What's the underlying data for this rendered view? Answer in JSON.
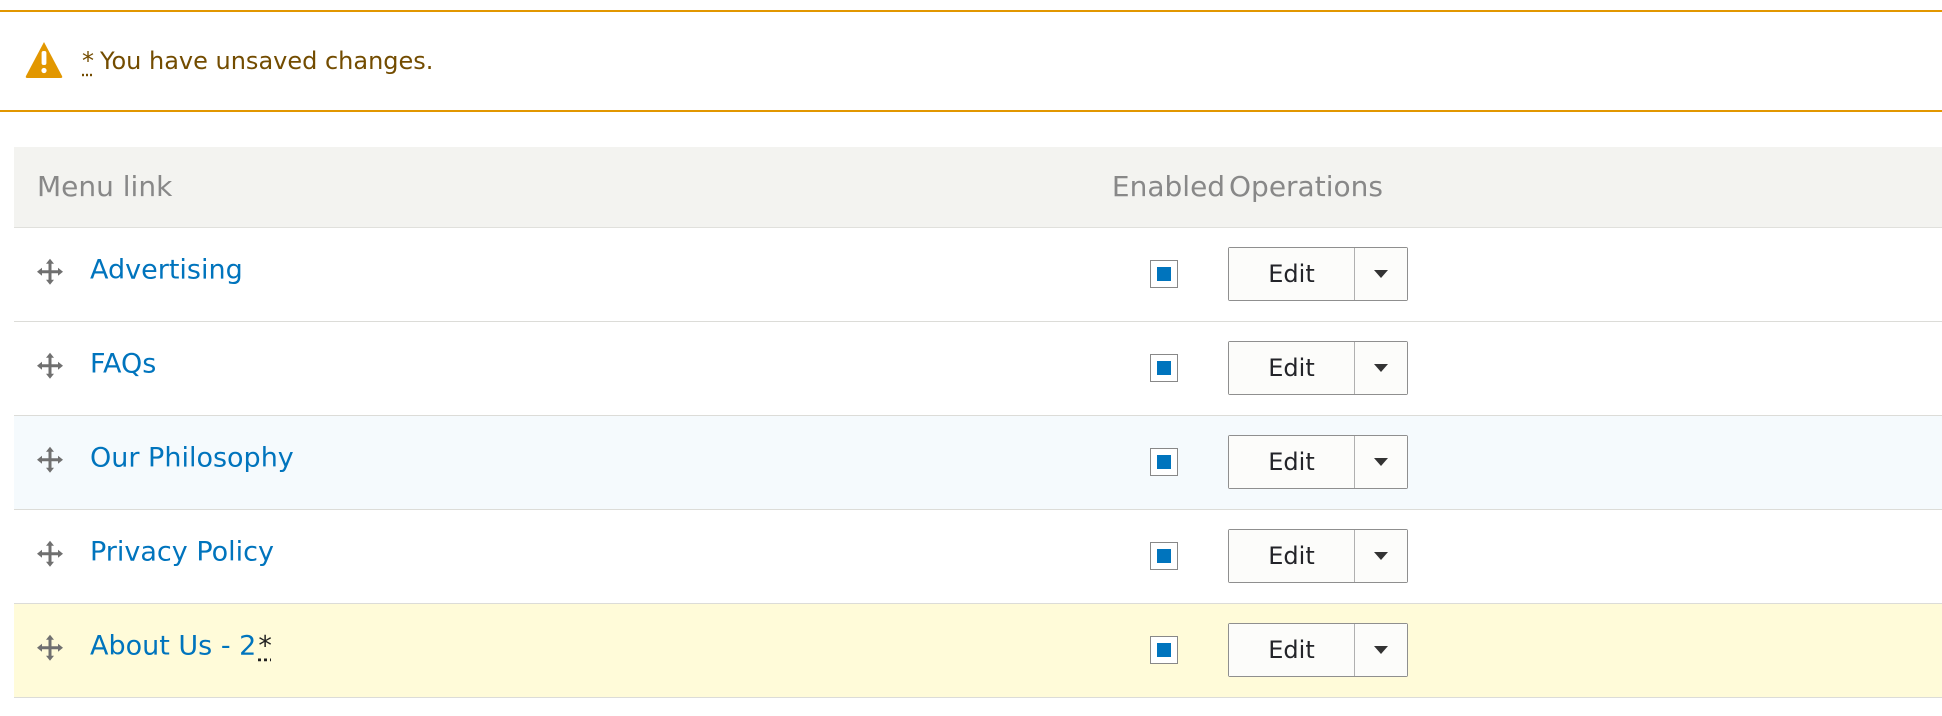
{
  "status": {
    "icon": "warning-icon",
    "marker": "*",
    "message": "You have unsaved changes.",
    "color": "#e29700"
  },
  "table": {
    "columns": {
      "menu_link": "Menu link",
      "enabled": "Enabled",
      "operations": "Operations"
    },
    "rows": [
      {
        "label": "Advertising",
        "enabled": true,
        "edit_label": "Edit",
        "state": "normal",
        "icon": "drag-handle-icon"
      },
      {
        "label": "FAQs",
        "enabled": true,
        "edit_label": "Edit",
        "state": "normal",
        "icon": "drag-handle-icon"
      },
      {
        "label": "Our Philosophy",
        "enabled": true,
        "edit_label": "Edit",
        "state": "highlighted",
        "icon": "drag-handle-icon"
      },
      {
        "label": "Privacy Policy",
        "enabled": true,
        "edit_label": "Edit",
        "state": "normal",
        "icon": "drag-handle-icon"
      },
      {
        "label": "About Us - 2",
        "changed_marker": "*",
        "enabled": true,
        "edit_label": "Edit",
        "state": "changed",
        "icon": "drag-handle-icon"
      }
    ]
  },
  "colors": {
    "link": "#0074bd",
    "checkbox": "#0074bd",
    "header_background": "#f3f3f0",
    "highlight_row": "#f5fafd",
    "changed_row": "#fffbd9"
  }
}
